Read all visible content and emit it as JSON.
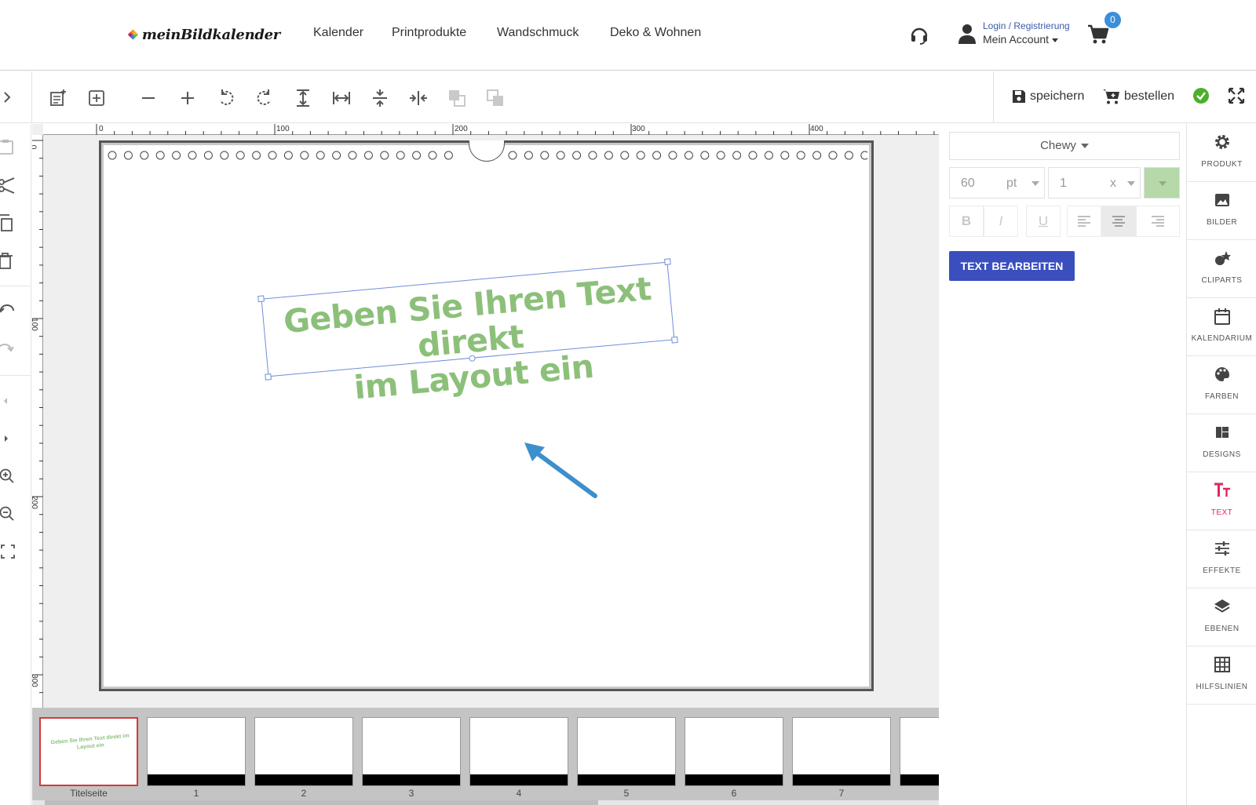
{
  "nav": {
    "brand": "meinBildkalender",
    "links": [
      "Kalender",
      "Printprodukte",
      "Wandschmuck",
      "Deko & Wohnen"
    ],
    "login_label": "Login / Registrierung",
    "account_label": "Mein Account",
    "cart_count": "0"
  },
  "toolbar": {
    "save_label": "speichern",
    "order_label": "bestellen"
  },
  "ruler": {
    "top": [
      "0",
      "100",
      "200",
      "300",
      "400"
    ],
    "left": [
      "0",
      "100",
      "200",
      "300"
    ]
  },
  "canvas": {
    "text_line1": "Geben Sie Ihren Text direkt",
    "text_line2": "im Layout ein",
    "text_color": "#8cc07a"
  },
  "thumbnails": {
    "labels": [
      "Titelseite",
      "1",
      "2",
      "3",
      "4",
      "5",
      "6",
      "7"
    ],
    "mini_text": "Geben Sie Ihren Text direkt im Layout ein"
  },
  "text_panel": {
    "font": "Chewy",
    "size_value": "60",
    "size_unit": "pt",
    "line_value": "1",
    "line_unit": "x",
    "bold": "B",
    "italic": "I",
    "underline": "U",
    "edit_button": "TEXT BEARBEITEN",
    "swatch_color": "#b5d9a8"
  },
  "sidebar": {
    "items": [
      "PRODUKT",
      "BILDER",
      "CLIPARTS",
      "KALENDARIUM",
      "FARBEN",
      "DESIGNS",
      "TEXT",
      "EFFEKTE",
      "EBENEN",
      "HILFSLINIEN"
    ],
    "active": "TEXT",
    "accent": "#e2265f"
  }
}
